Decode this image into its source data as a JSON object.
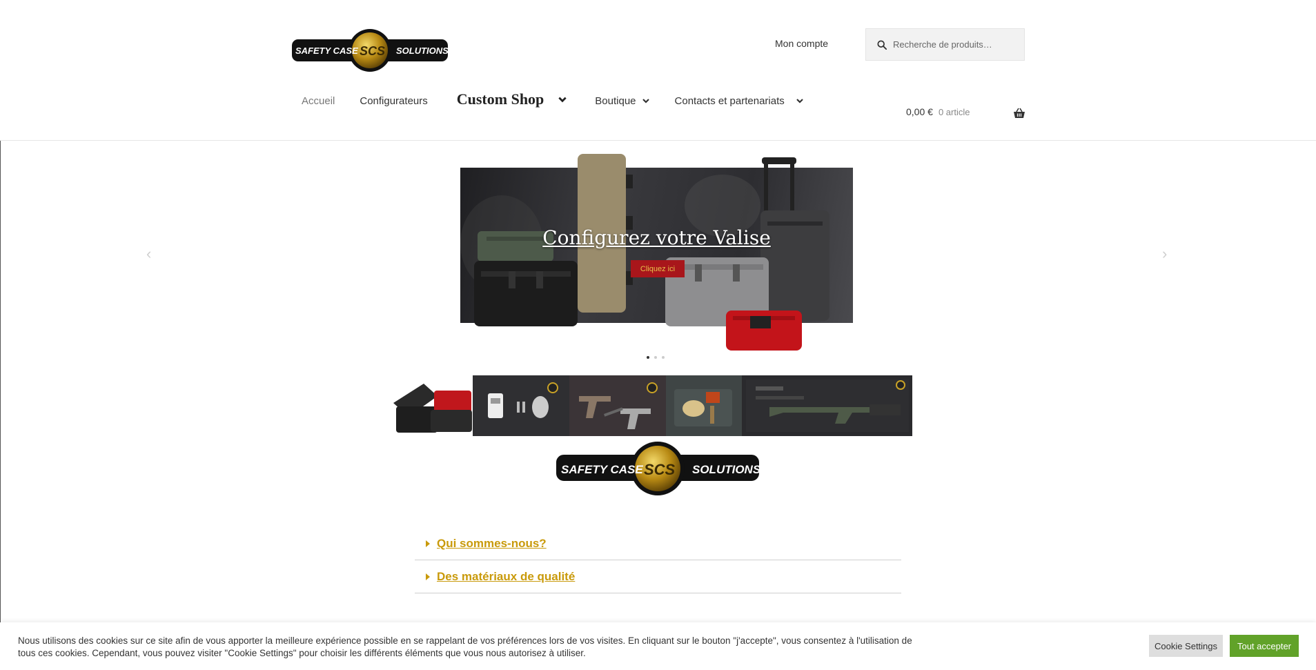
{
  "header": {
    "logo": {
      "left_text": "SAFETY CASE",
      "center_text": "SCS",
      "right_text": "SOLUTIONS"
    },
    "account_label": "Mon compte",
    "search": {
      "placeholder": "Recherche de produits…",
      "icon": "search-icon"
    },
    "cart": {
      "amount": "0,00 €",
      "count": "0 article",
      "icon": "basket-icon"
    }
  },
  "nav": {
    "items": [
      {
        "label": "Accueil",
        "has_dropdown": false
      },
      {
        "label": "Configurateurs",
        "has_dropdown": false
      },
      {
        "label": "Custom Shop",
        "has_dropdown": true
      },
      {
        "label": "Boutique",
        "has_dropdown": true
      },
      {
        "label": "Contacts et partenariats",
        "has_dropdown": true
      }
    ]
  },
  "slider": {
    "title": "Configurez votre Valise",
    "button_label": "Cliquez ici",
    "prev_icon": "chevron-left-icon",
    "next_icon": "chevron-right-icon",
    "slide_count": 3,
    "active_index": 0
  },
  "brand_logo": {
    "left_text": "SAFETY CASE",
    "center_text": "SCS",
    "right_text": "SOLUTIONS"
  },
  "accordion": {
    "items": [
      {
        "label": "Qui sommes-nous?"
      },
      {
        "label": "Des matériaux de qualité"
      }
    ]
  },
  "cookie_banner": {
    "text": "Nous utilisons des cookies sur ce site afin de vous apporter la meilleure expérience possible en se rappelant de vos préférences lors de vos visites. En cliquant sur le bouton \"j'accepte\", vous consentez à l'utilisation de tous ces cookies. Cependant, vous pouvez visiter \"Cookie Settings\" pour choisir les différents éléments que vous nous autorisez à utiliser.",
    "settings_label": "Cookie Settings",
    "accept_label": "Tout accepter"
  },
  "colors": {
    "accent_gold": "#c99a0b",
    "accept_green": "#61a229",
    "slide_button_red": "#a8161b"
  }
}
